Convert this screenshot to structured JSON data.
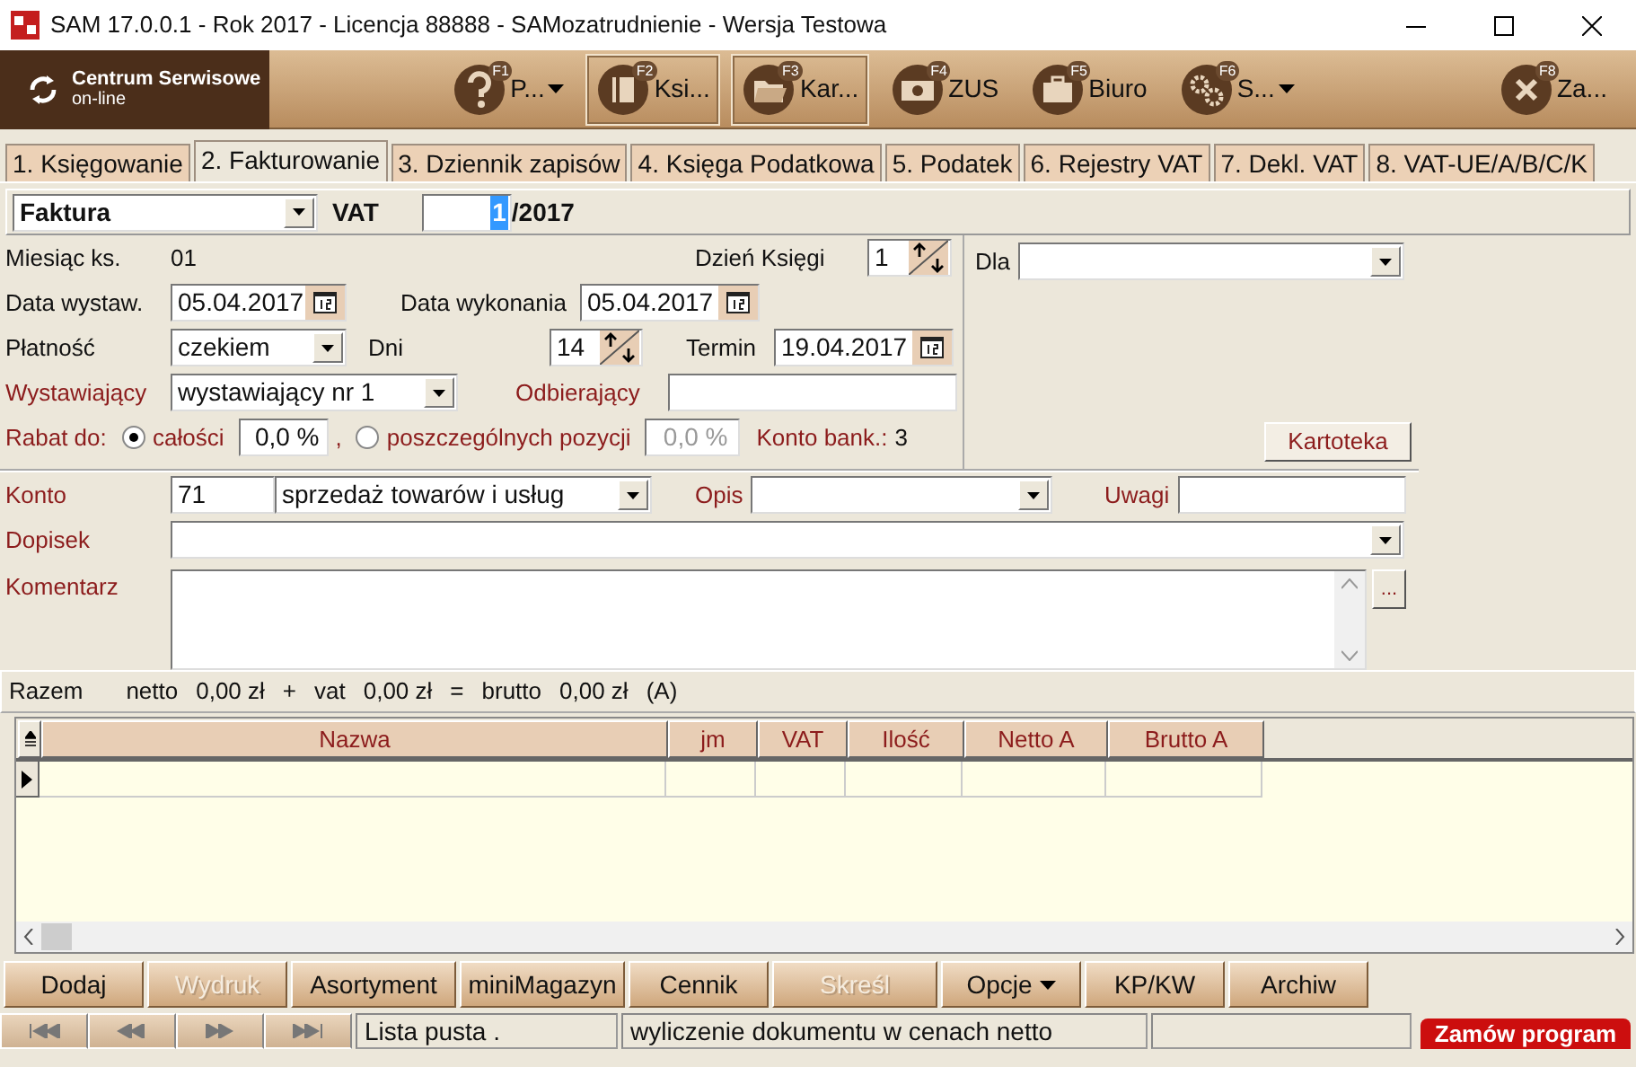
{
  "window": {
    "title": "SAM 17.0.0.1 - Rok 2017 - Licencja 88888 - SAMozatrudnienie - Wersja Testowa"
  },
  "logo": {
    "title": "Centrum Serwisowe",
    "subtitle": "on-line"
  },
  "toolbar": [
    {
      "kind": "help",
      "key": "F1",
      "label": "P...",
      "dropdown": true,
      "pressed": false
    },
    {
      "kind": "book",
      "key": "F2",
      "label": "Ksi...",
      "dropdown": false,
      "pressed": true
    },
    {
      "kind": "folder",
      "key": "F3",
      "label": "Kar...",
      "dropdown": false,
      "pressed": true
    },
    {
      "kind": "money",
      "key": "F4",
      "label": "ZUS",
      "dropdown": false,
      "pressed": false
    },
    {
      "kind": "briefcase",
      "key": "F5",
      "label": "Biuro",
      "dropdown": false,
      "pressed": false
    },
    {
      "kind": "gears",
      "key": "F6",
      "label": "S...",
      "dropdown": true,
      "pressed": false
    },
    {
      "kind": "close",
      "key": "F8",
      "label": "Za...",
      "dropdown": false,
      "pressed": false
    }
  ],
  "tabs": [
    {
      "label": "1. Księgowanie",
      "selected": false
    },
    {
      "label": "2. Fakturowanie",
      "selected": true
    },
    {
      "label": "3. Dziennik zapisów",
      "selected": false
    },
    {
      "label": "4. Księga Podatkowa",
      "selected": false
    },
    {
      "label": "5. Podatek",
      "selected": false
    },
    {
      "label": "6. Rejestry VAT",
      "selected": false
    },
    {
      "label": "7. Dekl. VAT",
      "selected": false
    },
    {
      "label": "8. VAT-UE/A/B/C/K",
      "selected": false
    }
  ],
  "document": {
    "type": "Faktura",
    "register": "VAT",
    "number": "1",
    "year": "/2017"
  },
  "form": {
    "month_label": "Miesiąc ks.",
    "month": "01",
    "day_label": "Dzień Księgi",
    "day": "1",
    "issue_label": "Data wystaw.",
    "issue_date": "05.04.2017",
    "exec_label": "Data wykonania",
    "exec_date": "05.04.2017",
    "payment_label": "Płatność",
    "payment": "czekiem",
    "days_label": "Dni",
    "days": "14",
    "due_label": "Termin",
    "due_date": "19.04.2017",
    "issuer_label": "Wystawiający",
    "issuer": "wystawiający nr 1",
    "recipient_label": "Odbierający",
    "discount_label": "Rabat do:",
    "separator": ",",
    "discount_options": [
      {
        "label": "całości",
        "value": "0,0 %",
        "selected": true,
        "disabled": false
      },
      {
        "label": "poszczególnych pozycji",
        "value": "0,0 %",
        "selected": false,
        "disabled": true
      }
    ],
    "bank_label": "Konto bank.:",
    "bank": "3"
  },
  "recipient_panel": {
    "for_label": "Dla",
    "button": "Kartoteka"
  },
  "posting": {
    "account_label": "Konto",
    "account": "71",
    "account_name": "sprzedaż towarów i usług",
    "desc_label": "Opis",
    "notes_label": "Uwagi",
    "addendum_label": "Dopisek",
    "comment_label": "Komentarz",
    "comment_button": "..."
  },
  "totals": [
    "Razem",
    "netto",
    "0,00 zł",
    "+",
    "vat",
    "0,00 zł",
    "=",
    "brutto",
    "0,00 zł",
    "(A)"
  ],
  "table": {
    "columns": [
      "Nazwa",
      "jm",
      "VAT",
      "Ilość",
      "Netto A",
      "Brutto A"
    ]
  },
  "buttons": [
    {
      "label": "Dodaj",
      "disabled": false,
      "dropdown": false
    },
    {
      "label": "Wydruk",
      "disabled": true,
      "dropdown": false
    },
    {
      "label": "Asortyment",
      "disabled": false,
      "dropdown": false
    },
    {
      "label": "miniMagazyn",
      "disabled": false,
      "dropdown": false
    },
    {
      "label": "Cennik",
      "disabled": false,
      "dropdown": false
    },
    {
      "label": "Skreśl",
      "disabled": true,
      "dropdown": false
    },
    {
      "label": "Opcje",
      "disabled": false,
      "dropdown": true
    },
    {
      "label": "KP/KW",
      "disabled": false,
      "dropdown": false
    },
    {
      "label": "Archiw",
      "disabled": false,
      "dropdown": false
    }
  ],
  "status_bar": {
    "messages": [
      "Lista pusta .",
      "wyliczenie dokumentu w cenach netto"
    ],
    "order_button": "Zamów program"
  }
}
